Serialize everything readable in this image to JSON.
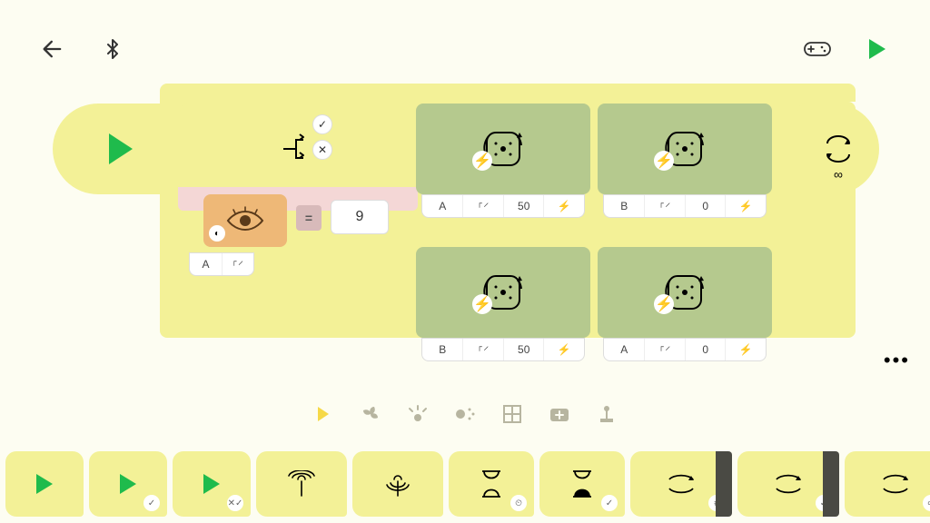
{
  "toolbar": {
    "back": "back",
    "bluetooth": "bluetooth",
    "controller": "controller",
    "run": "run"
  },
  "program": {
    "start": {
      "label": "start"
    },
    "switch": {
      "branch_true": "✓",
      "branch_false": "✕",
      "condition": {
        "sensor": "color",
        "op": "=",
        "value": "9",
        "port": "A",
        "mode": "⸀⸍"
      }
    },
    "loop": {
      "mode": "∞"
    },
    "motors": [
      {
        "port": "A",
        "dir": "⸀⸍",
        "speed": "50",
        "unit": "⚡"
      },
      {
        "port": "B",
        "dir": "⸀⸍",
        "speed": "0",
        "unit": "⚡"
      },
      {
        "port": "B",
        "dir": "⸀⸍",
        "speed": "50",
        "unit": "⚡"
      },
      {
        "port": "A",
        "dir": "⸀⸍",
        "speed": "0",
        "unit": "⚡"
      }
    ]
  },
  "categories": [
    "flow",
    "motor",
    "light",
    "sound",
    "display",
    "event",
    "more"
  ],
  "palette": [
    {
      "type": "start",
      "badge": ""
    },
    {
      "type": "start",
      "badge": "✓"
    },
    {
      "type": "start",
      "badge": "✕✓"
    },
    {
      "type": "broadcast",
      "badge": ""
    },
    {
      "type": "receive",
      "badge": ""
    },
    {
      "type": "wait-time",
      "badge": "⏲"
    },
    {
      "type": "wait-until",
      "badge": "✓"
    },
    {
      "type": "loop-count",
      "badge": "#"
    },
    {
      "type": "loop-until",
      "badge": "✓"
    },
    {
      "type": "loop-forever",
      "badge": "∞"
    },
    {
      "type": "switch",
      "badge": ""
    }
  ],
  "menu": {
    "more": "•••"
  }
}
